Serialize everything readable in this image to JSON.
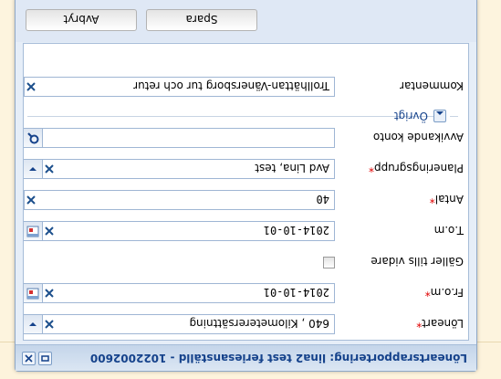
{
  "dialog": {
    "title": "Löneartsrapportering: lina2 test feriesanställd - 1022002600"
  },
  "form": {
    "loneart": {
      "label": "Löneart",
      "value": "640 , Kilometerersättning"
    },
    "from_date": {
      "label": "Fr.o.m",
      "value": "2014-10-01"
    },
    "valid_until_further": {
      "label": "Gäller tills vidare"
    },
    "to_date": {
      "label": "T.o.m",
      "value": "2014-10-01"
    },
    "antal": {
      "label": "Antal",
      "value": "40"
    },
    "planning_group": {
      "label": "Planeringsgrupp",
      "value": "Avd Lina, test"
    },
    "alt_account": {
      "label": "Avvikande konto",
      "value": ""
    },
    "comment": {
      "label": "Kommentar",
      "value": "Trollhättan-Vänersborg tur och retur"
    }
  },
  "other_section": {
    "label": "Övrigt"
  },
  "buttons": {
    "save": "Spara",
    "cancel": "Avbryt"
  },
  "colors": {
    "title": "#15428b",
    "required": "#e00000",
    "border": "#9fb6d4"
  }
}
